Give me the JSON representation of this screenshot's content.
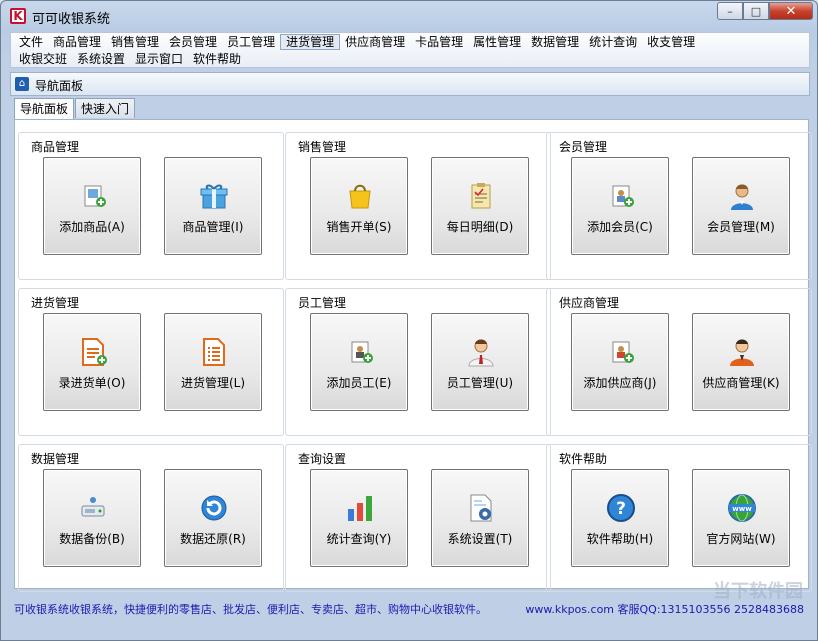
{
  "window": {
    "title": "可可收银系统",
    "app_icon_letter": "K"
  },
  "menubar": {
    "row1": [
      "文件",
      "商品管理",
      "销售管理",
      "会员管理",
      "员工管理",
      "进货管理",
      "供应商管理",
      "卡品管理",
      "属性管理",
      "数据管理",
      "统计查询",
      "收支管理"
    ],
    "row2": [
      "收银交班",
      "系统设置",
      "显示窗口",
      "软件帮助"
    ],
    "active": "进货管理"
  },
  "panel": {
    "title": "导航面板"
  },
  "tabs": [
    "导航面板",
    "快速入门"
  ],
  "groups": [
    {
      "title": "商品管理",
      "tiles": [
        {
          "label": "添加商品(A)",
          "icon": "add-product-icon"
        },
        {
          "label": "商品管理(I)",
          "icon": "gift-box-icon"
        }
      ]
    },
    {
      "title": "销售管理",
      "tiles": [
        {
          "label": "销售开单(S)",
          "icon": "shopping-bag-icon"
        },
        {
          "label": "每日明细(D)",
          "icon": "clipboard-icon"
        }
      ]
    },
    {
      "title": "会员管理",
      "tiles": [
        {
          "label": "添加会员(C)",
          "icon": "add-member-icon"
        },
        {
          "label": "会员管理(M)",
          "icon": "member-person-icon"
        }
      ]
    },
    {
      "title": "进货管理",
      "tiles": [
        {
          "label": "录进货单(O)",
          "icon": "add-document-icon"
        },
        {
          "label": "进货管理(L)",
          "icon": "document-list-icon"
        }
      ]
    },
    {
      "title": "员工管理",
      "tiles": [
        {
          "label": "添加员工(E)",
          "icon": "add-employee-icon"
        },
        {
          "label": "员工管理(U)",
          "icon": "employee-person-icon"
        }
      ]
    },
    {
      "title": "供应商管理",
      "tiles": [
        {
          "label": "添加供应商(J)",
          "icon": "add-supplier-icon"
        },
        {
          "label": "供应商管理(K)",
          "icon": "supplier-person-icon"
        }
      ]
    },
    {
      "title": "数据管理",
      "tiles": [
        {
          "label": "数据备份(B)",
          "icon": "backup-drive-icon"
        },
        {
          "label": "数据还原(R)",
          "icon": "restore-icon"
        }
      ]
    },
    {
      "title": "查询设置",
      "tiles": [
        {
          "label": "统计查询(Y)",
          "icon": "bar-chart-icon"
        },
        {
          "label": "系统设置(T)",
          "icon": "settings-document-icon"
        }
      ]
    },
    {
      "title": "软件帮助",
      "tiles": [
        {
          "label": "软件帮助(H)",
          "icon": "help-icon"
        },
        {
          "label": "官方网站(W)",
          "icon": "website-globe-icon"
        }
      ]
    }
  ],
  "status": {
    "left": "可收银系统收银系统，快捷便利的零售店、批发店、便利店、专卖店、超市、购物中心收银软件。",
    "right": "www.kkpos.com  客服QQ:1315103556 2528483688"
  },
  "watermark": "当下软件园"
}
